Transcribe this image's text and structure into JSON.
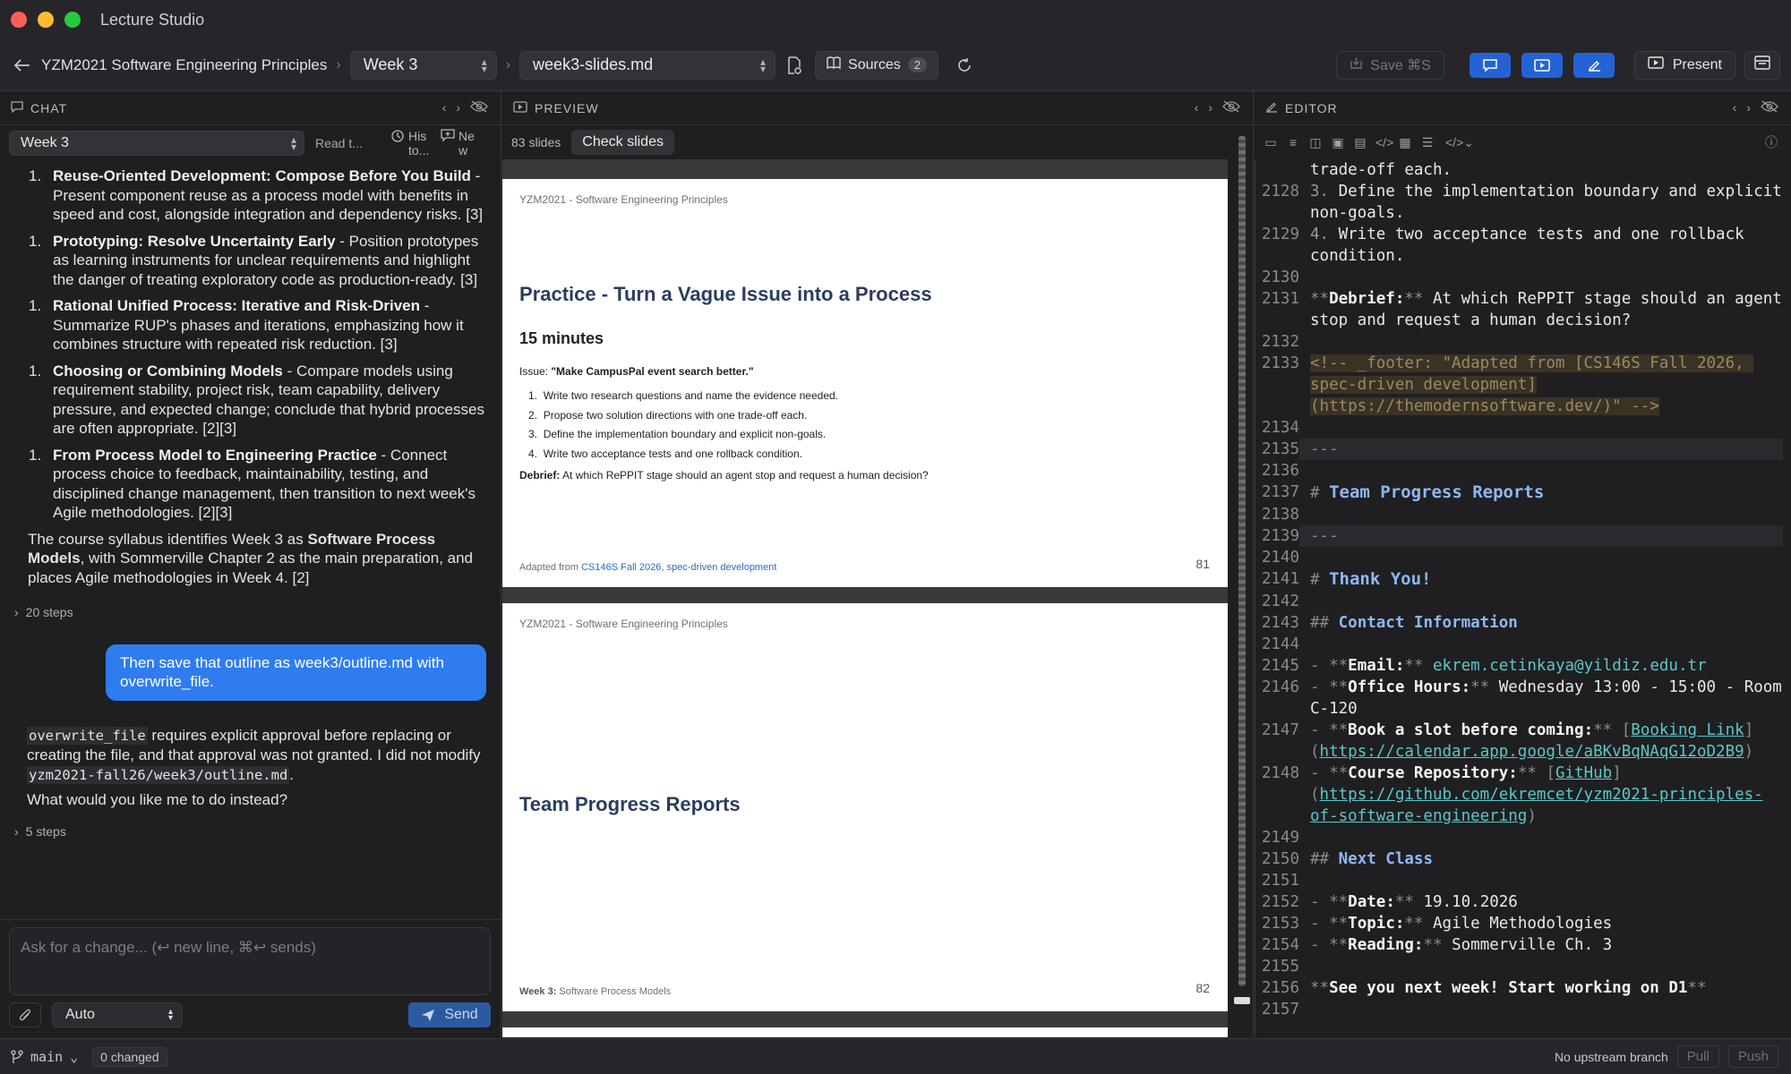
{
  "window": {
    "title": "Lecture Studio"
  },
  "toolbar": {
    "course": "YZM2021 Software Engineering Principles",
    "week": "Week 3",
    "file": "week3-slides.md",
    "sources_label": "Sources",
    "sources_count": "2",
    "save_label": "Save ⌘S",
    "present_label": "Present"
  },
  "chat": {
    "header": "CHAT",
    "week_select": "Week 3",
    "read_label": "Read t...",
    "history_label": "His to...",
    "new_label": "Ne w",
    "items": [
      {
        "num": "1.",
        "title": "Reuse-Oriented Development: Compose Before You Build",
        "text": " - Present component reuse as a process model with benefits in speed and cost, alongside integration and dependency risks. [3]"
      },
      {
        "num": "1.",
        "title": "Prototyping: Resolve Uncertainty Early",
        "text": " - Position prototypes as learning instruments for unclear requirements and highlight the danger of treating exploratory code as production-ready. [3]"
      },
      {
        "num": "1.",
        "title": "Rational Unified Process: Iterative and Risk-Driven",
        "text": " - Summarize RUP's phases and iterations, emphasizing how it combines structure with repeated risk reduction. [3]"
      },
      {
        "num": "1.",
        "title": "Choosing or Combining Models",
        "text": " - Compare models using requirement stability, project risk, team capability, delivery pressure, and expected change; conclude that hybrid processes are often appropriate. [2][3]"
      },
      {
        "num": "1.",
        "title": "From Process Model to Engineering Practice",
        "text": " - Connect process choice to feedback, maintainability, testing, and disciplined change management, then transition to next week's Agile methodologies. [2][3]"
      }
    ],
    "summary_pre": "The course syllabus identifies Week 3 as ",
    "summary_bold": "Software Process Models",
    "summary_post": ", with Sommerville Chapter 2 as the main preparation, and places Agile methodologies in Week 4. [2]",
    "steps1": "20 steps",
    "user_message": "Then save that outline as week3/outline.md with overwrite_file.",
    "reply_code1": "overwrite_file",
    "reply_text1": " requires explicit approval before replacing or creating the file, and that approval was not granted. I did not modify ",
    "reply_code2": "yzm2021-fall26/week3/outline.md",
    "reply_text2": ".",
    "reply_question": "What would you like me to do instead?",
    "steps2": "5 steps",
    "input_placeholder": "Ask for a change... (↩ new line, ⌘↩ sends)",
    "mode_select": "Auto",
    "send_label": "Send"
  },
  "preview": {
    "header": "PREVIEW",
    "slide_count": "83 slides",
    "check_label": "Check slides",
    "slides": [
      {
        "header": "YZM2021 - Software Engineering Principles",
        "title": "Practice - Turn a Vague Issue into a Process",
        "subtitle": "15 minutes",
        "issue_label": "Issue: ",
        "issue_text": "\"Make CampusPal event search better.\"",
        "list": [
          "Write two research questions and name the evidence needed.",
          "Propose two solution directions with one trade-off each.",
          "Define the implementation boundary and explicit non-goals.",
          "Write two acceptance tests and one rollback condition."
        ],
        "debrief_label": "Debrief:",
        "debrief_text": " At which RePPIT stage should an agent stop and request a human decision?",
        "footer_pre": "Adapted from ",
        "footer_link": "CS146S Fall 2026, spec-driven development",
        "number": "81"
      },
      {
        "header": "YZM2021 - Software Engineering Principles",
        "title": "Team Progress Reports",
        "footer_bold": "Week 3:",
        "footer_text": " Software Process Models",
        "number": "82"
      }
    ]
  },
  "editor": {
    "header": "EDITOR",
    "lines": [
      {
        "n": "",
        "t": "trade-off each."
      },
      {
        "n": "2128",
        "t": "3. Define the implementation boundary and explicit non-goals."
      },
      {
        "n": "2129",
        "t": "4. Write two acceptance tests and one rollback condition."
      },
      {
        "n": "2130",
        "t": ""
      },
      {
        "n": "2131",
        "t": "**Debrief:** At which RePPIT stage should an agent stop and request a human decision?"
      },
      {
        "n": "2132",
        "t": ""
      },
      {
        "n": "2133",
        "t": "<!-- _footer: \"Adapted from [CS146S Fall 2026, spec-driven development](https://themodernsoftware.dev/)\" -->"
      },
      {
        "n": "2134",
        "t": ""
      },
      {
        "n": "2135",
        "t": "---"
      },
      {
        "n": "2136",
        "t": ""
      },
      {
        "n": "2137",
        "t": "# Team Progress Reports"
      },
      {
        "n": "2138",
        "t": ""
      },
      {
        "n": "2139",
        "t": "---"
      },
      {
        "n": "2140",
        "t": ""
      },
      {
        "n": "2141",
        "t": "# Thank You!"
      },
      {
        "n": "2142",
        "t": ""
      },
      {
        "n": "2143",
        "t": "## Contact Information"
      },
      {
        "n": "2144",
        "t": ""
      },
      {
        "n": "2145",
        "t": "- **Email:** ekrem.cetinkaya@yildiz.edu.tr"
      },
      {
        "n": "2146",
        "t": "- **Office Hours:** Wednesday 13:00 - 15:00 - Room C-120"
      },
      {
        "n": "2147",
        "t": "- **Book a slot before coming:** [Booking Link](https://calendar.app.google/aBKvBqNAqG12oD2B9)"
      },
      {
        "n": "2148",
        "t": "- **Course Repository:** [GitHub](https://github.com/ekremcet/yzm2021-principles-of-software-engineering)"
      },
      {
        "n": "2149",
        "t": ""
      },
      {
        "n": "2150",
        "t": "## Next Class"
      },
      {
        "n": "2151",
        "t": ""
      },
      {
        "n": "2152",
        "t": "- **Date:** 19.10.2026"
      },
      {
        "n": "2153",
        "t": "- **Topic:** Agile Methodologies"
      },
      {
        "n": "2154",
        "t": "- **Reading:** Sommerville Ch. 3"
      },
      {
        "n": "2155",
        "t": ""
      },
      {
        "n": "2156",
        "t": "**See you next week! Start working on D1**"
      },
      {
        "n": "2157",
        "t": ""
      }
    ]
  },
  "status": {
    "branch": "main",
    "changed": "0 changed",
    "upstream": "No upstream branch",
    "pull": "Pull",
    "push": "Push"
  },
  "colors": {
    "accent": "#2f7cf0",
    "mode_button": "#2463d6",
    "send_button": "#2c5aa0"
  }
}
